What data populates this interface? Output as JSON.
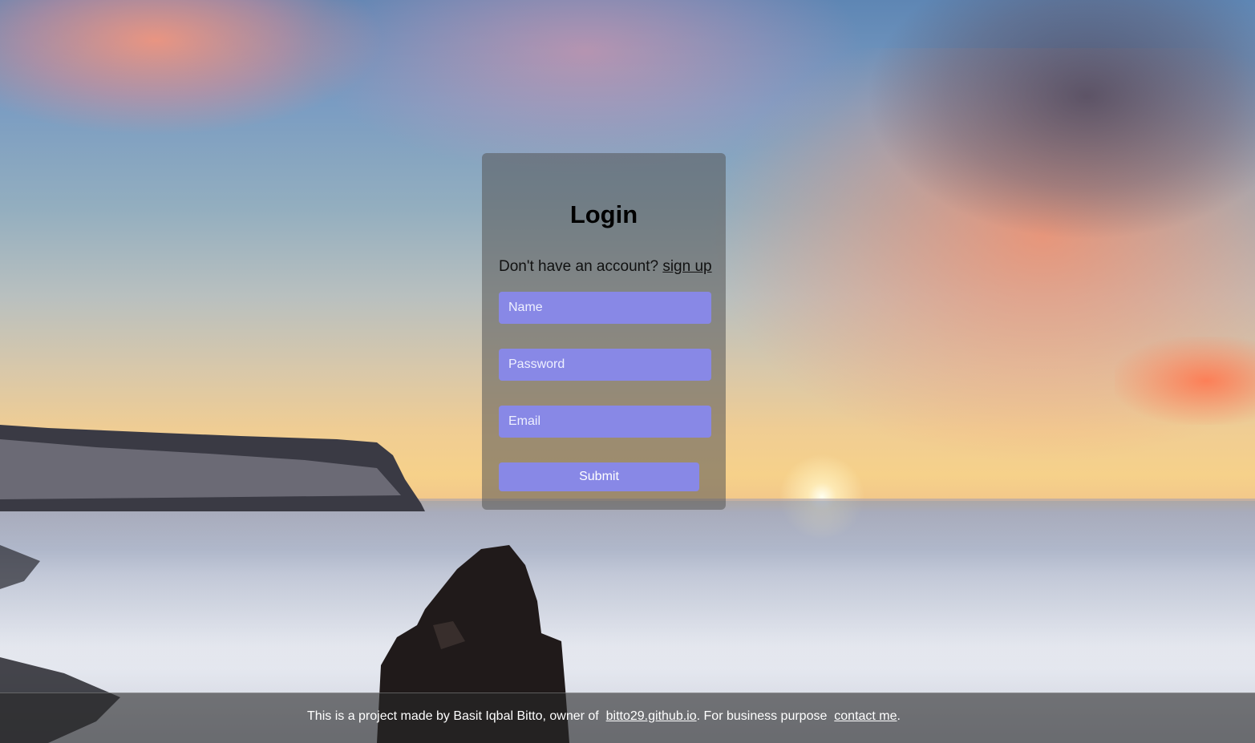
{
  "login": {
    "title": "Login",
    "signup_prompt": "Don't have an account?",
    "signup_link": "sign up",
    "name_placeholder": "Name",
    "password_placeholder": "Password",
    "email_placeholder": "Email",
    "submit_label": "Submit"
  },
  "footer": {
    "text_before": "This is a project made by Basit Iqbal Bitto, owner of",
    "site_link": "bitto29.github.io",
    "text_middle": ". For business purpose",
    "contact_link": "contact me",
    "text_after": "."
  },
  "colors": {
    "input_bg": "#8888e6",
    "card_bg": "rgba(85,85,85,0.55)",
    "footer_bg": "rgba(40,40,40,0.6)"
  },
  "background": {
    "icon": "sunset-seascape-photo"
  }
}
